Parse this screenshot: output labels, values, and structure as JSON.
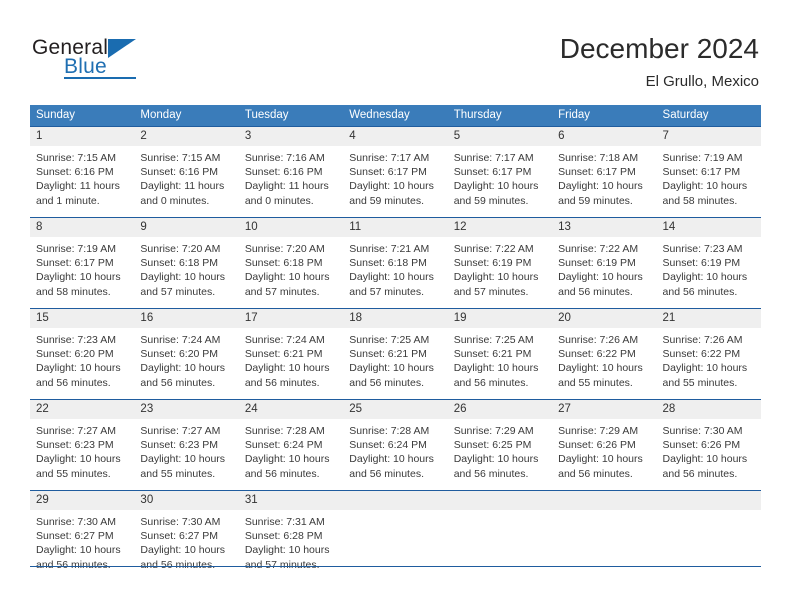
{
  "brand": {
    "name_part1": "General",
    "name_part2": "Blue",
    "logo_icon": "triangle-flag-icon"
  },
  "header": {
    "month_title": "December 2024",
    "location": "El Grullo, Mexico"
  },
  "colors": {
    "header_blue": "#3a7cba",
    "rule_blue": "#1f5c9e",
    "daynum_band": "#efefef",
    "brand_blue": "#1a6cb0"
  },
  "weekdays": [
    "Sunday",
    "Monday",
    "Tuesday",
    "Wednesday",
    "Thursday",
    "Friday",
    "Saturday"
  ],
  "weeks": [
    [
      {
        "day": "1",
        "sunrise": "Sunrise: 7:15 AM",
        "sunset": "Sunset: 6:16 PM",
        "daylight_1": "Daylight: 11 hours",
        "daylight_2": "and 1 minute."
      },
      {
        "day": "2",
        "sunrise": "Sunrise: 7:15 AM",
        "sunset": "Sunset: 6:16 PM",
        "daylight_1": "Daylight: 11 hours",
        "daylight_2": "and 0 minutes."
      },
      {
        "day": "3",
        "sunrise": "Sunrise: 7:16 AM",
        "sunset": "Sunset: 6:16 PM",
        "daylight_1": "Daylight: 11 hours",
        "daylight_2": "and 0 minutes."
      },
      {
        "day": "4",
        "sunrise": "Sunrise: 7:17 AM",
        "sunset": "Sunset: 6:17 PM",
        "daylight_1": "Daylight: 10 hours",
        "daylight_2": "and 59 minutes."
      },
      {
        "day": "5",
        "sunrise": "Sunrise: 7:17 AM",
        "sunset": "Sunset: 6:17 PM",
        "daylight_1": "Daylight: 10 hours",
        "daylight_2": "and 59 minutes."
      },
      {
        "day": "6",
        "sunrise": "Sunrise: 7:18 AM",
        "sunset": "Sunset: 6:17 PM",
        "daylight_1": "Daylight: 10 hours",
        "daylight_2": "and 59 minutes."
      },
      {
        "day": "7",
        "sunrise": "Sunrise: 7:19 AM",
        "sunset": "Sunset: 6:17 PM",
        "daylight_1": "Daylight: 10 hours",
        "daylight_2": "and 58 minutes."
      }
    ],
    [
      {
        "day": "8",
        "sunrise": "Sunrise: 7:19 AM",
        "sunset": "Sunset: 6:17 PM",
        "daylight_1": "Daylight: 10 hours",
        "daylight_2": "and 58 minutes."
      },
      {
        "day": "9",
        "sunrise": "Sunrise: 7:20 AM",
        "sunset": "Sunset: 6:18 PM",
        "daylight_1": "Daylight: 10 hours",
        "daylight_2": "and 57 minutes."
      },
      {
        "day": "10",
        "sunrise": "Sunrise: 7:20 AM",
        "sunset": "Sunset: 6:18 PM",
        "daylight_1": "Daylight: 10 hours",
        "daylight_2": "and 57 minutes."
      },
      {
        "day": "11",
        "sunrise": "Sunrise: 7:21 AM",
        "sunset": "Sunset: 6:18 PM",
        "daylight_1": "Daylight: 10 hours",
        "daylight_2": "and 57 minutes."
      },
      {
        "day": "12",
        "sunrise": "Sunrise: 7:22 AM",
        "sunset": "Sunset: 6:19 PM",
        "daylight_1": "Daylight: 10 hours",
        "daylight_2": "and 57 minutes."
      },
      {
        "day": "13",
        "sunrise": "Sunrise: 7:22 AM",
        "sunset": "Sunset: 6:19 PM",
        "daylight_1": "Daylight: 10 hours",
        "daylight_2": "and 56 minutes."
      },
      {
        "day": "14",
        "sunrise": "Sunrise: 7:23 AM",
        "sunset": "Sunset: 6:19 PM",
        "daylight_1": "Daylight: 10 hours",
        "daylight_2": "and 56 minutes."
      }
    ],
    [
      {
        "day": "15",
        "sunrise": "Sunrise: 7:23 AM",
        "sunset": "Sunset: 6:20 PM",
        "daylight_1": "Daylight: 10 hours",
        "daylight_2": "and 56 minutes."
      },
      {
        "day": "16",
        "sunrise": "Sunrise: 7:24 AM",
        "sunset": "Sunset: 6:20 PM",
        "daylight_1": "Daylight: 10 hours",
        "daylight_2": "and 56 minutes."
      },
      {
        "day": "17",
        "sunrise": "Sunrise: 7:24 AM",
        "sunset": "Sunset: 6:21 PM",
        "daylight_1": "Daylight: 10 hours",
        "daylight_2": "and 56 minutes."
      },
      {
        "day": "18",
        "sunrise": "Sunrise: 7:25 AM",
        "sunset": "Sunset: 6:21 PM",
        "daylight_1": "Daylight: 10 hours",
        "daylight_2": "and 56 minutes."
      },
      {
        "day": "19",
        "sunrise": "Sunrise: 7:25 AM",
        "sunset": "Sunset: 6:21 PM",
        "daylight_1": "Daylight: 10 hours",
        "daylight_2": "and 56 minutes."
      },
      {
        "day": "20",
        "sunrise": "Sunrise: 7:26 AM",
        "sunset": "Sunset: 6:22 PM",
        "daylight_1": "Daylight: 10 hours",
        "daylight_2": "and 55 minutes."
      },
      {
        "day": "21",
        "sunrise": "Sunrise: 7:26 AM",
        "sunset": "Sunset: 6:22 PM",
        "daylight_1": "Daylight: 10 hours",
        "daylight_2": "and 55 minutes."
      }
    ],
    [
      {
        "day": "22",
        "sunrise": "Sunrise: 7:27 AM",
        "sunset": "Sunset: 6:23 PM",
        "daylight_1": "Daylight: 10 hours",
        "daylight_2": "and 55 minutes."
      },
      {
        "day": "23",
        "sunrise": "Sunrise: 7:27 AM",
        "sunset": "Sunset: 6:23 PM",
        "daylight_1": "Daylight: 10 hours",
        "daylight_2": "and 55 minutes."
      },
      {
        "day": "24",
        "sunrise": "Sunrise: 7:28 AM",
        "sunset": "Sunset: 6:24 PM",
        "daylight_1": "Daylight: 10 hours",
        "daylight_2": "and 56 minutes."
      },
      {
        "day": "25",
        "sunrise": "Sunrise: 7:28 AM",
        "sunset": "Sunset: 6:24 PM",
        "daylight_1": "Daylight: 10 hours",
        "daylight_2": "and 56 minutes."
      },
      {
        "day": "26",
        "sunrise": "Sunrise: 7:29 AM",
        "sunset": "Sunset: 6:25 PM",
        "daylight_1": "Daylight: 10 hours",
        "daylight_2": "and 56 minutes."
      },
      {
        "day": "27",
        "sunrise": "Sunrise: 7:29 AM",
        "sunset": "Sunset: 6:26 PM",
        "daylight_1": "Daylight: 10 hours",
        "daylight_2": "and 56 minutes."
      },
      {
        "day": "28",
        "sunrise": "Sunrise: 7:30 AM",
        "sunset": "Sunset: 6:26 PM",
        "daylight_1": "Daylight: 10 hours",
        "daylight_2": "and 56 minutes."
      }
    ],
    [
      {
        "day": "29",
        "sunrise": "Sunrise: 7:30 AM",
        "sunset": "Sunset: 6:27 PM",
        "daylight_1": "Daylight: 10 hours",
        "daylight_2": "and 56 minutes."
      },
      {
        "day": "30",
        "sunrise": "Sunrise: 7:30 AM",
        "sunset": "Sunset: 6:27 PM",
        "daylight_1": "Daylight: 10 hours",
        "daylight_2": "and 56 minutes."
      },
      {
        "day": "31",
        "sunrise": "Sunrise: 7:31 AM",
        "sunset": "Sunset: 6:28 PM",
        "daylight_1": "Daylight: 10 hours",
        "daylight_2": "and 57 minutes."
      },
      null,
      null,
      null,
      null
    ]
  ]
}
